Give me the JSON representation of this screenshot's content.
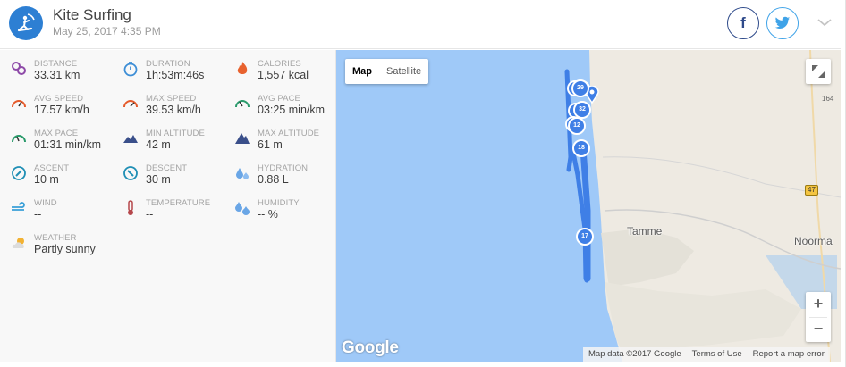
{
  "header": {
    "title": "Kite Surfing",
    "date": "May 25, 2017 4:35 PM",
    "sport_icon": "kite-surfer-icon",
    "share": {
      "facebook_icon": "facebook-icon",
      "twitter_icon": "twitter-icon",
      "expand_icon": "chevron-down-icon"
    }
  },
  "stats": [
    {
      "label": "DISTANCE",
      "value": "33.31 km",
      "icon": "location-pins-icon",
      "color": "#8e4aa8"
    },
    {
      "label": "DURATION",
      "value": "1h:53m:46s",
      "icon": "stopwatch-icon",
      "color": "#3d8ed6"
    },
    {
      "label": "CALORIES",
      "value": "1,557 kcal",
      "icon": "flame-icon",
      "color": "#e8622e"
    },
    {
      "label": "AVG SPEED",
      "value": "17.57 km/h",
      "icon": "speedometer-icon",
      "color": "#e55a2b"
    },
    {
      "label": "MAX SPEED",
      "value": "39.53 km/h",
      "icon": "speedometer-icon",
      "color": "#e55a2b"
    },
    {
      "label": "AVG PACE",
      "value": "03:25 min/km",
      "icon": "pace-gauge-icon",
      "color": "#2a9a6b"
    },
    {
      "label": "MAX PACE",
      "value": "01:31 min/km",
      "icon": "pace-gauge-icon",
      "color": "#2a9a6b"
    },
    {
      "label": "MIN ALTITUDE",
      "value": "42 m",
      "icon": "mountain-icon",
      "color": "#3a4f8a"
    },
    {
      "label": "MAX ALTITUDE",
      "value": "61 m",
      "icon": "mountain-icon",
      "color": "#3a4f8a"
    },
    {
      "label": "ASCENT",
      "value": "10 m",
      "icon": "ascent-compass-icon",
      "color": "#1f8fb5"
    },
    {
      "label": "DESCENT",
      "value": "30 m",
      "icon": "descent-compass-icon",
      "color": "#1f8fb5"
    },
    {
      "label": "HYDRATION",
      "value": "0.88 L",
      "icon": "water-drops-icon",
      "color": "#6aa6e6"
    },
    {
      "label": "WIND",
      "value": "--",
      "icon": "wind-icon",
      "color": "#3aa0d8"
    },
    {
      "label": "TEMPERATURE",
      "value": "--",
      "icon": "thermometer-icon",
      "color": "#b5474b"
    },
    {
      "label": "HUMIDITY",
      "value": "-- %",
      "icon": "humidity-drops-icon",
      "color": "#6aa6e6"
    },
    {
      "label": "WEATHER",
      "value": "Partly sunny",
      "icon": "partly-sunny-icon",
      "color": "#f2b233"
    }
  ],
  "map": {
    "map_type_buttons": [
      "Map",
      "Satellite"
    ],
    "active_type": "Map",
    "zoom_in": "+",
    "zoom_out": "−",
    "logo": "Google",
    "attribution": [
      "Map data ©2017 Google",
      "Terms of Use",
      "Report a map error"
    ],
    "places": [
      "Tamme",
      "Noorma"
    ],
    "road_labels": [
      "47",
      "164"
    ],
    "markers": [
      "29",
      "32",
      "12",
      "18",
      "17"
    ],
    "colors": {
      "water": "#9fc9f8",
      "land": "#eeeae2",
      "track": "#3f7fe6"
    }
  }
}
